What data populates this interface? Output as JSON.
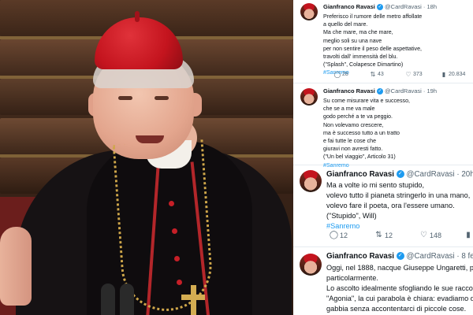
{
  "tweets": [
    {
      "name": "Gianfranco Ravasi",
      "handle": "@CardRavasi",
      "time": "18h",
      "lines": [
        "Preferisco il rumore delle metro affollate",
        "a quello del mare.",
        "Ma che mare, ma che mare,",
        "meglio soli su una nave",
        "per non sentire il peso delle aspettative,",
        "travolti dall' immensità del blu.",
        "(\"Splash\", Colapesce Dimartino)"
      ],
      "hashtag": "#Sanremo",
      "stats": {
        "replies": "28",
        "retweets": "43",
        "likes": "373",
        "views": "20.834"
      }
    },
    {
      "name": "Gianfranco Ravasi",
      "handle": "@CardRavasi",
      "time": "19h",
      "lines": [
        "Su come misurare vita e successo,",
        "che se a me va male",
        "godo perché a te va peggio.",
        "Non volevamo crescere,",
        "ma è successo tutto a un tratto",
        "e fai tutte le cose che",
        "giuravi non avresti fatto.",
        "(\"Un bel viaggio\", Articolo 31)"
      ],
      "hashtag": "#Sanremo"
    },
    {
      "name": "Gianfranco Ravasi",
      "handle": "@CardRavasi",
      "time": "20h",
      "lines": [
        "Ma a volte io mi sento stupido,",
        "volevo tutto il pianeta stringerlo in una mano,",
        "volevo fare il poeta, ora l'essere umano.",
        "(\"Stupido\", Will)"
      ],
      "hashtag": "#Sanremo",
      "stats": {
        "replies": "12",
        "retweets": "12",
        "likes": "148"
      }
    },
    {
      "name": "Gianfranco Ravasi",
      "handle": "@CardRavasi",
      "time": "8 feb",
      "lines": [
        "Oggi, nel 1888, nacque Giuseppe Ungaretti, po",
        "particolarmente.",
        "Lo ascolto idealmente sfogliando le sue raccol",
        "\"Agonia\", la cui parabola è chiara: evadiamo da",
        "gabbia senza accontentarci di piccole cose."
      ]
    }
  ],
  "icons": {
    "verified": "✓",
    "reply": "◯",
    "retweet": "⇅",
    "like": "♡",
    "views": "▮",
    "share": "⇪"
  },
  "colors": {
    "accent": "#1d9bf0",
    "muted": "#536471",
    "cardinal_red": "#c4141e"
  }
}
